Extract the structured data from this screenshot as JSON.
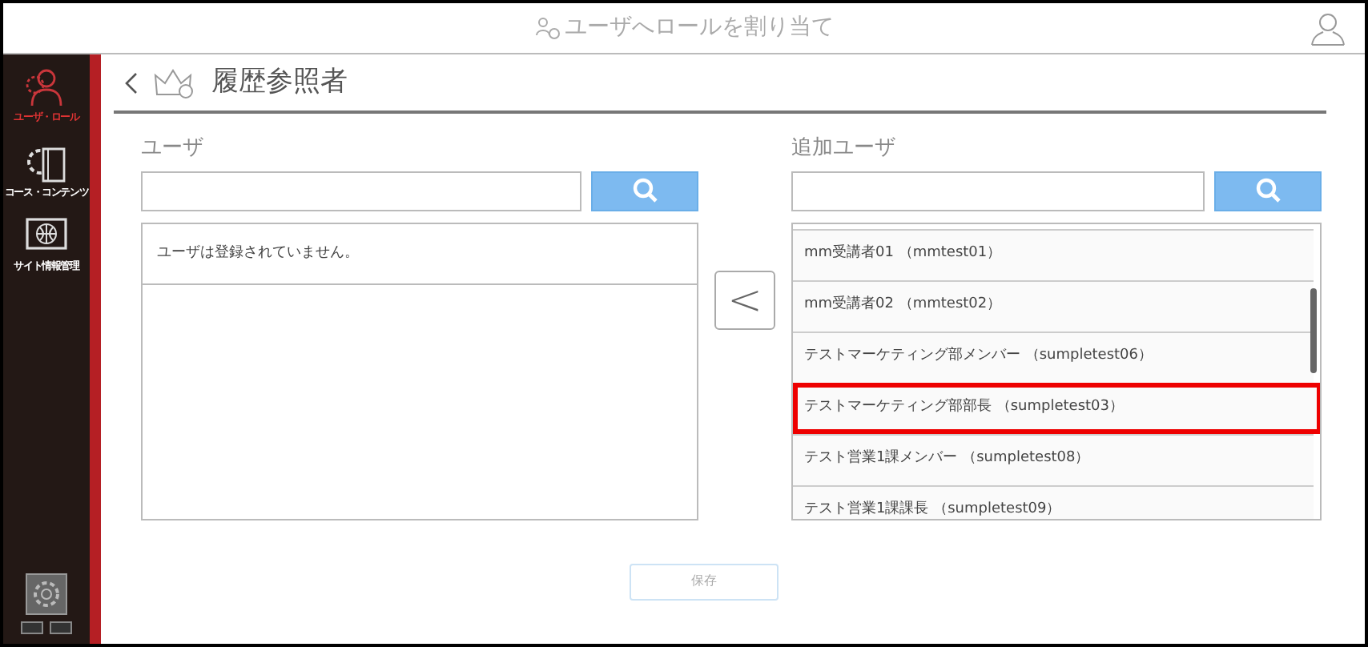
{
  "header": {
    "title": "ユーザへロールを割り当て"
  },
  "sidebar": {
    "items": [
      {
        "label": "ユーザ・ロール",
        "selected": true
      },
      {
        "label": "コース・コンテンツ",
        "selected": false
      },
      {
        "label": "サイト情報管理",
        "selected": false
      }
    ]
  },
  "page": {
    "title": "履歴参照者"
  },
  "users": {
    "label": "ユーザ",
    "empty_message": "ユーザは登録されていません。"
  },
  "added_users": {
    "label": "追加ユーザ",
    "items": [
      {
        "label": "mm受講者01 （mmtest01）",
        "highlighted": false
      },
      {
        "label": "mm受講者02 （mmtest02）",
        "highlighted": false
      },
      {
        "label": "テストマーケティング部メンバー （sumpletest06）",
        "highlighted": false
      },
      {
        "label": "テストマーケティング部部長 （sumpletest03）",
        "highlighted": true
      },
      {
        "label": "テスト営業1課メンバー （sumpletest08）",
        "highlighted": false
      },
      {
        "label": "テスト営業1課課長 （sumpletest09）",
        "highlighted": false
      }
    ]
  },
  "move_button": {
    "label": "<"
  },
  "save_button": {
    "label": "保存",
    "disabled": true
  }
}
